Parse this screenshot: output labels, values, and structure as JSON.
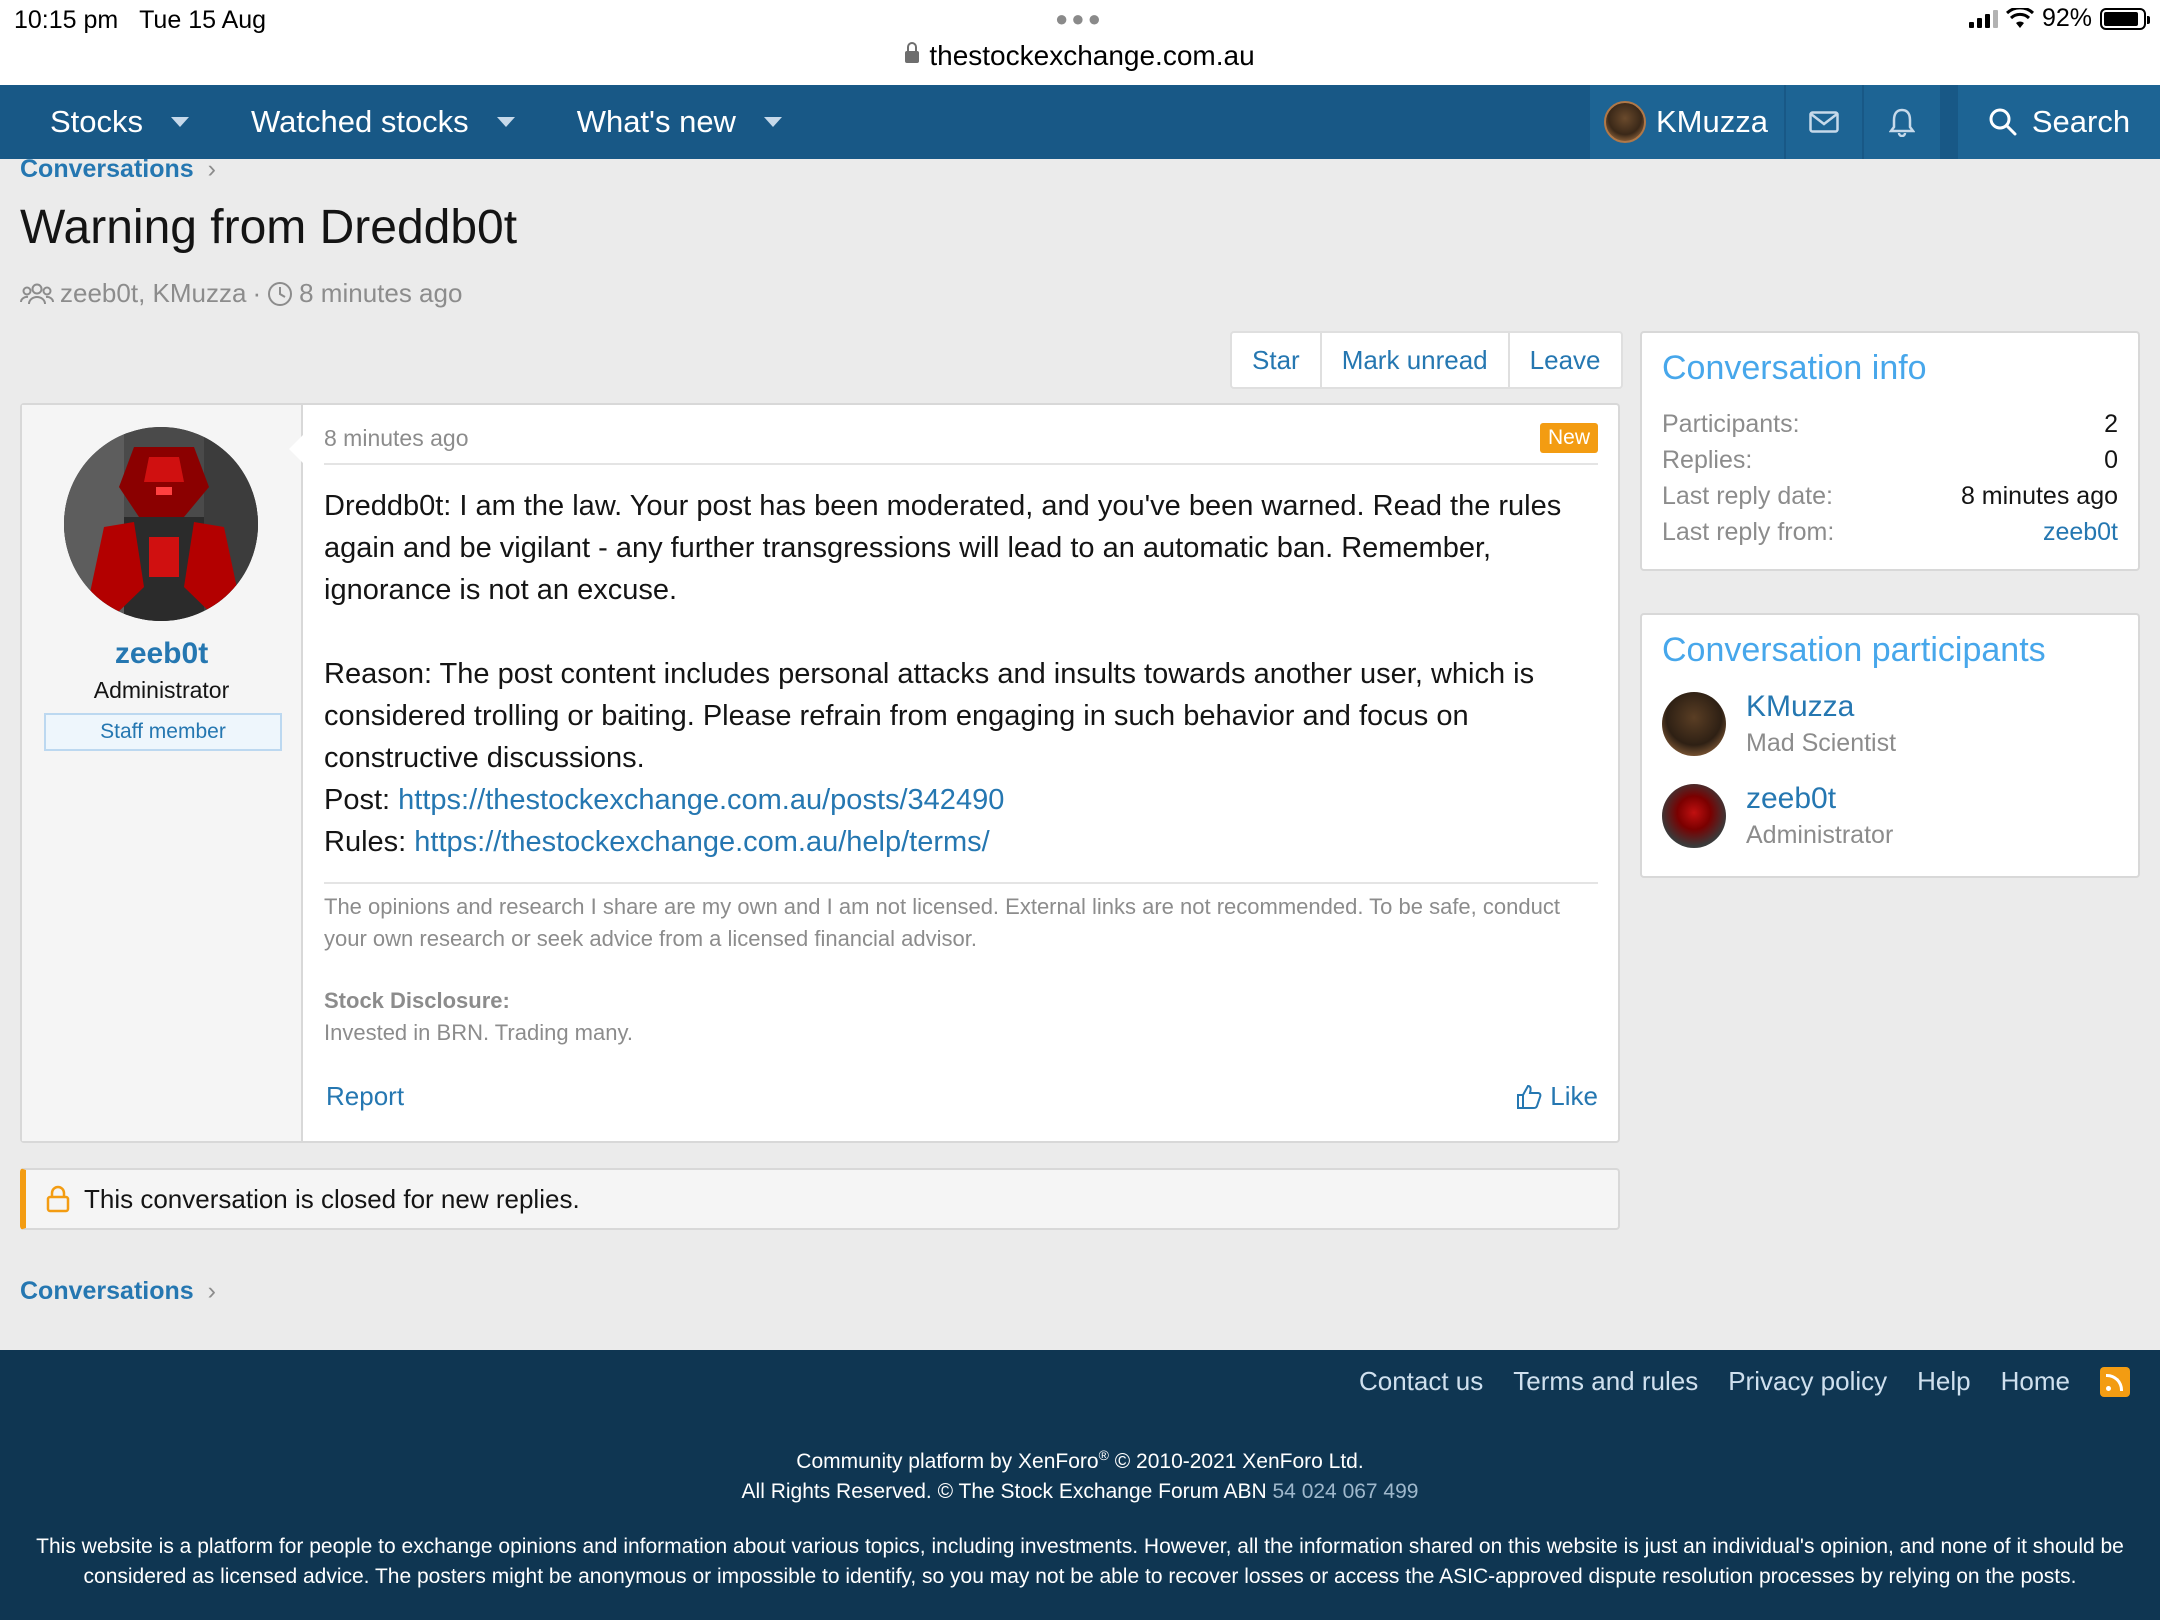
{
  "status_bar": {
    "time": "10:15 pm",
    "date": "Tue 15 Aug",
    "battery": "92%"
  },
  "url": "thestockexchange.com.au",
  "nav": {
    "items": [
      {
        "label": "Stocks"
      },
      {
        "label": "Watched stocks"
      },
      {
        "label": "What's new"
      }
    ],
    "user": "KMuzza",
    "search": "Search"
  },
  "breadcrumb": {
    "label": "Conversations"
  },
  "conversation": {
    "title": "Warning from Dreddb0t",
    "participants_text": "zeeb0t, KMuzza",
    "time": "8 minutes ago",
    "actions": {
      "star": "Star",
      "mark_unread": "Mark unread",
      "leave": "Leave"
    }
  },
  "message": {
    "username": "zeeb0t",
    "user_title": "Administrator",
    "staff_badge": "Staff member",
    "time": "8 minutes ago",
    "new_badge": "New",
    "para1": "Dreddb0t: I am the law. Your post has been moderated, and you've been warned. Read the rules again and be vigilant - any further transgressions will lead to an automatic ban. Remember, ignorance is not an excuse.",
    "para2": "Reason: The post content includes personal attacks and insults towards another user, which is considered trolling or baiting. Please refrain from engaging in such behavior and focus on constructive discussions.",
    "post_label": "Post: ",
    "post_link": "https://thestockexchange.com.au/posts/342490",
    "rules_label": "Rules: ",
    "rules_link": "https://thestockexchange.com.au/help/terms/",
    "signature": "The opinions and research I share are my own and I am not licensed. External links are not recommended. To be safe, conduct your own research or seek advice from a licensed financial advisor.",
    "disclosure_title": "Stock Disclosure:",
    "disclosure_text": "Invested in BRN. Trading many.",
    "report": "Report",
    "like": "Like"
  },
  "closed_notice": "This conversation is closed for new replies.",
  "sidebar": {
    "info": {
      "title": "Conversation info",
      "rows": [
        {
          "label": "Participants:",
          "value": "2"
        },
        {
          "label": "Replies:",
          "value": "0"
        },
        {
          "label": "Last reply date:",
          "value": "8 minutes ago"
        },
        {
          "label": "Last reply from:",
          "value": "zeeb0t"
        }
      ]
    },
    "participants": {
      "title": "Conversation participants",
      "list": [
        {
          "name": "KMuzza",
          "title": "Mad Scientist"
        },
        {
          "name": "zeeb0t",
          "title": "Administrator"
        }
      ]
    }
  },
  "footer": {
    "links": [
      "Contact us",
      "Terms and rules",
      "Privacy policy",
      "Help",
      "Home"
    ],
    "powered": "Community platform by XenForo",
    "reg": "®",
    "powered_rest": " © 2010-2021 XenForo Ltd.",
    "rights": "All Rights Reserved. © The Stock Exchange Forum ABN ",
    "abn": "54 024 067 499",
    "disclaimer": "This website is a platform for people to exchange opinions and information about various topics, including investments. However, all the information shared on this website is just an individual's opinion, and none of it should be considered as licensed advice. The posters might be anonymous or impossible to identify, so you may not be able to recover losses or access the ASIC-approved dispute resolution processes by relying on the posts."
  },
  "colors": {
    "nav_bg": "#185886",
    "link": "#2577b1",
    "accent": "#f39c12",
    "sidebar_title": "#47a7eb",
    "footer_bg": "#0f3652"
  }
}
